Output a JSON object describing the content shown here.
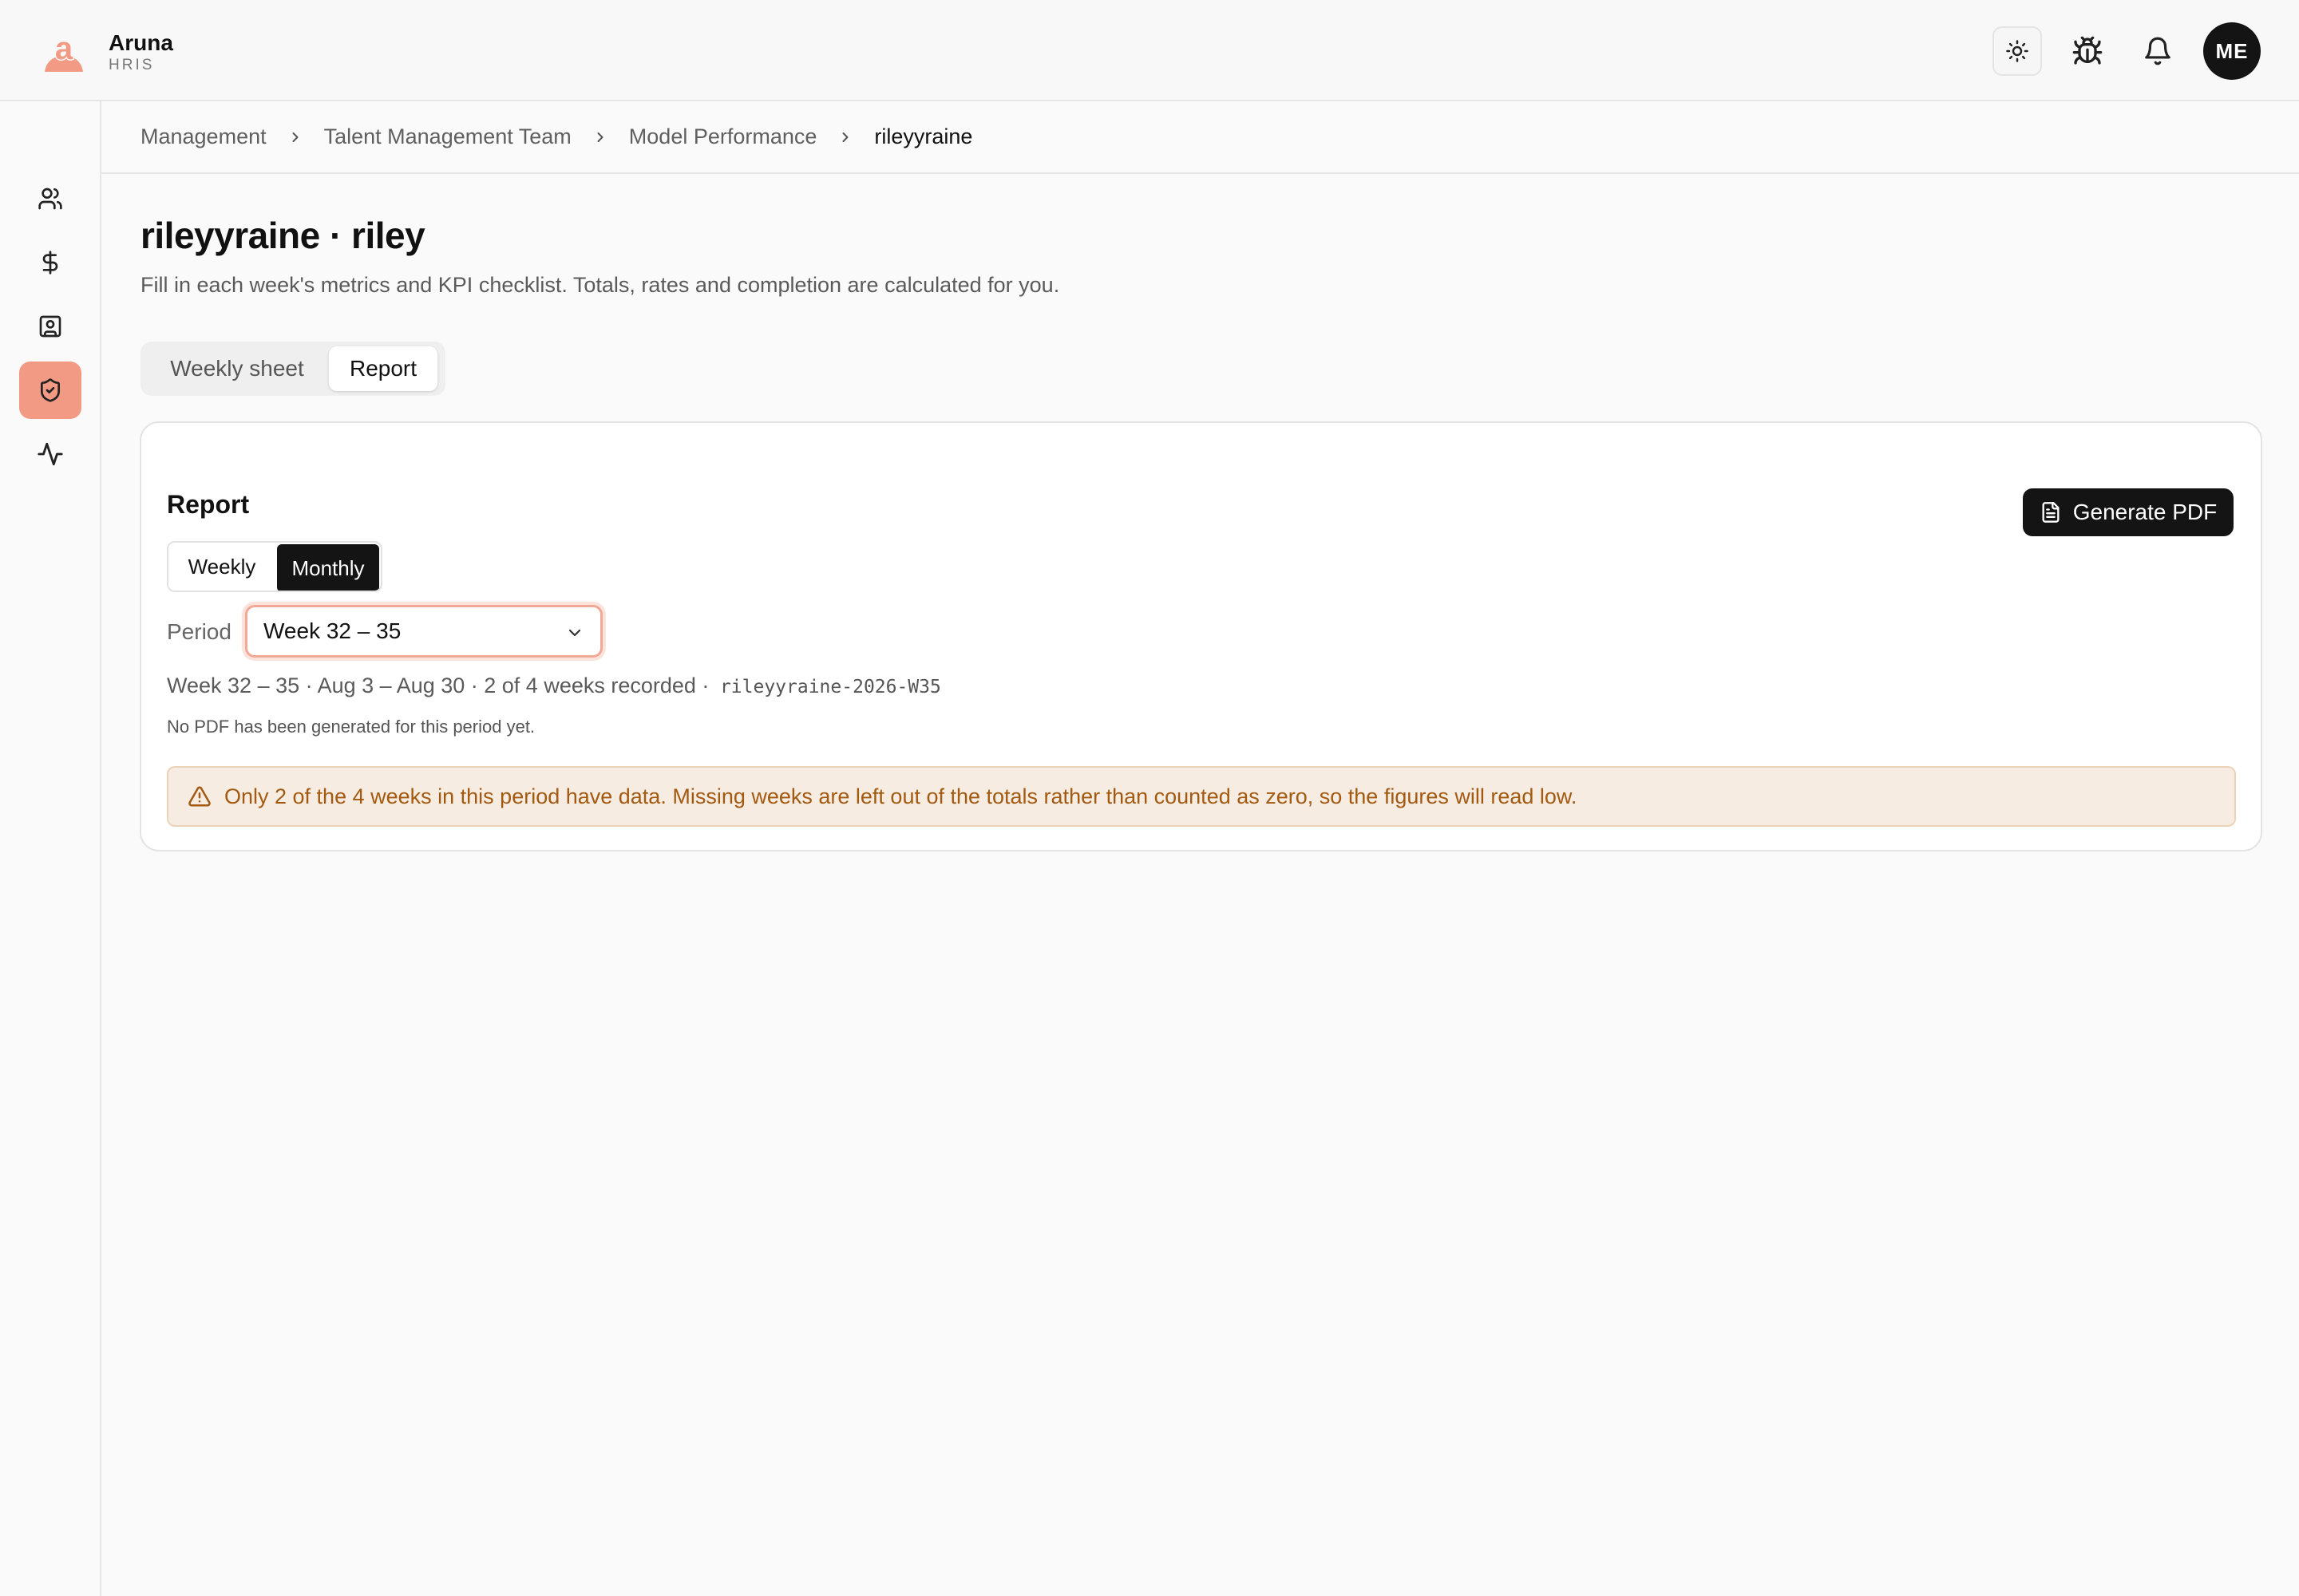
{
  "app": {
    "name": "Aruna",
    "subtitle": "HRIS"
  },
  "header": {
    "avatar_initials": "ME"
  },
  "breadcrumb": [
    "Management",
    "Talent Management Team",
    "Model Performance",
    "rileyyraine"
  ],
  "page": {
    "title": "rileyyraine · riley",
    "subtitle": "Fill in each week's metrics and KPI checklist. Totals, rates and completion are calculated for you."
  },
  "tabs": {
    "weekly_sheet": "Weekly sheet",
    "report": "Report",
    "active": "Report"
  },
  "report": {
    "title": "Report",
    "generate_label": "Generate PDF",
    "toggle": {
      "weekly": "Weekly",
      "monthly": "Monthly",
      "active": "Monthly"
    },
    "period_label": "Period",
    "period_value": "Week 32 – 35",
    "meta_text": "Week 32 – 35 · Aug 3 – Aug 30 · 2 of 4 weeks recorded ·",
    "meta_code": "rileyyraine-2026-W35",
    "no_pdf": "No PDF has been generated for this period yet.",
    "warning": "Only 2 of the 4 weeks in this period have data. Missing weeks are left out of the totals rather than counted as zero, so the figures will read low."
  },
  "sidebar": {
    "items": [
      {
        "icon": "users-icon"
      },
      {
        "icon": "dollar-icon"
      },
      {
        "icon": "contact-card-icon"
      },
      {
        "icon": "shield-check-icon",
        "active": true
      },
      {
        "icon": "activity-icon"
      }
    ]
  },
  "colors": {
    "accent": "#f29a84",
    "dark": "#141414",
    "warning_text": "#a35a10",
    "warning_bg": "#f6ece2"
  }
}
